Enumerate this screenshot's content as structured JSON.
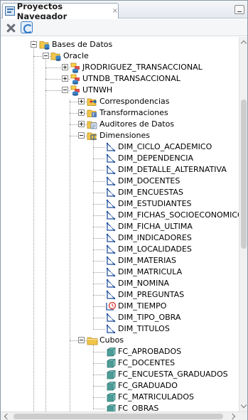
{
  "tab": {
    "title": "Proyectos Navegador",
    "close_glyph": "×"
  },
  "toolbar": {
    "delete_icon": "delete-x-icon",
    "refresh_icon": "refresh-icon"
  },
  "colors": {
    "folder": "#f2c64b",
    "dimension": "#1f4f9c",
    "cube": "#3c8f8a",
    "db": "#3d86c6",
    "accent_red": "#d8302a"
  },
  "tree": {
    "root": {
      "label": "Bases de Datos",
      "expanded": true
    },
    "oracle": {
      "label": "Oracle",
      "expanded": true
    },
    "schemas": [
      {
        "label": "JRODRIGUEZ_TRANSACCIONAL",
        "expanded": false
      },
      {
        "label": "UTNDB_TRANSACCIONAL",
        "expanded": false
      },
      {
        "label": "UTNWH",
        "expanded": true
      }
    ],
    "utnwh_children": [
      {
        "label": "Correspondencias",
        "expanded": false,
        "icon": "mappings-icon"
      },
      {
        "label": "Transformaciones",
        "expanded": false,
        "icon": "transformations-icon"
      },
      {
        "label": "Auditores de Datos",
        "expanded": false,
        "icon": "data-auditors-icon"
      },
      {
        "label": "Dimensiones",
        "expanded": true,
        "icon": "dimensions-icon"
      }
    ],
    "dimensions": [
      "DIM_CICLO_ACADEMICO",
      "DIM_DEPENDENCIA",
      "DIM_DETALLE_ALTERNATIVA",
      "DIM_DOCENTES",
      "DIM_ENCUESTAS",
      "DIM_ESTUDIANTES",
      "DIM_FICHAS_SOCIOECONOMICO",
      "DIM_FICHA_ULTIMA",
      "DIM_INDICADORES",
      "DIM_LOCALIDADES",
      "DIM_MATERIAS",
      "DIM_MATRICULA",
      "DIM_NOMINA",
      "DIM_PREGUNTAS",
      "DIM_TIEMPO",
      "DIM_TIPO_OBRA",
      "DIM_TITULOS"
    ],
    "cubes_folder": {
      "label": "Cubos",
      "expanded": true
    },
    "cubes": [
      "FC_APROBADOS",
      "FC_DOCENTES",
      "FC_ENCUESTA_GRADUADOS",
      "FC_GRADUADO",
      "FC_MATRICULADOS",
      "FC_OBRAS"
    ]
  }
}
